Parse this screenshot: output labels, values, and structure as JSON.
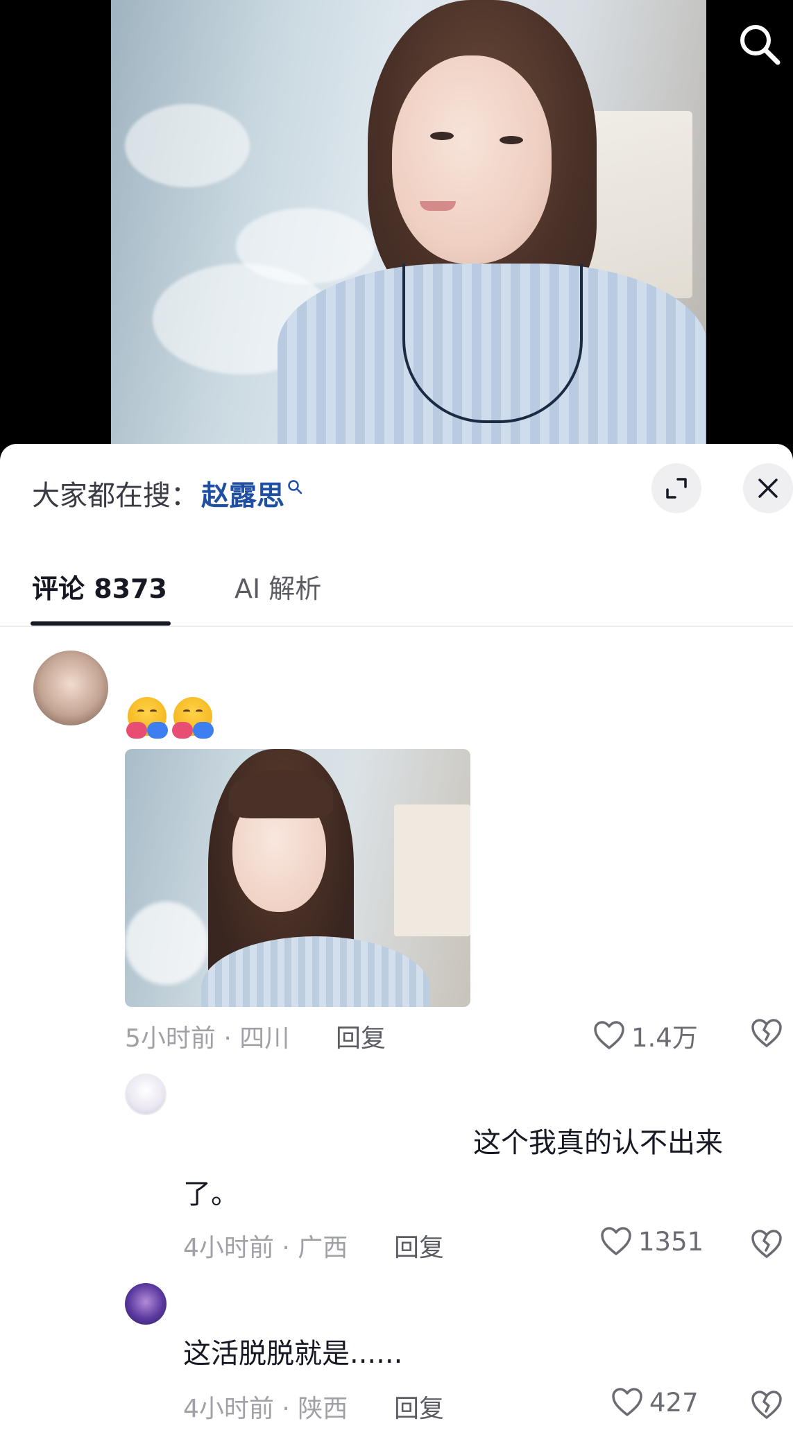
{
  "hot_search": {
    "prefix": "大家都在搜：",
    "keyword": "赵露思"
  },
  "tabs": [
    {
      "label": "评论 8373"
    },
    {
      "label": "AI 解析"
    }
  ],
  "comments": [
    {
      "meta": "5小时前 · 四川",
      "reply_label": "回复",
      "likes": "1.4万",
      "image_alt": "comment-photo"
    },
    {
      "text_line1": "这个我真的认不出来",
      "text_line2": "了。",
      "meta": "4小时前 · 广西",
      "reply_label": "回复",
      "likes": "1351"
    },
    {
      "text": "这活脱脱就是......",
      "meta": "4小时前 · 陕西",
      "reply_label": "回复",
      "likes": "427"
    }
  ],
  "icons": {
    "search": "search-icon",
    "expand": "expand-icon",
    "close": "close-icon",
    "like": "heart-icon",
    "dislike": "broken-heart-icon"
  },
  "colors": {
    "keyword": "#1f4fa3",
    "text": "#161823",
    "meta": "#a0a1a7"
  }
}
